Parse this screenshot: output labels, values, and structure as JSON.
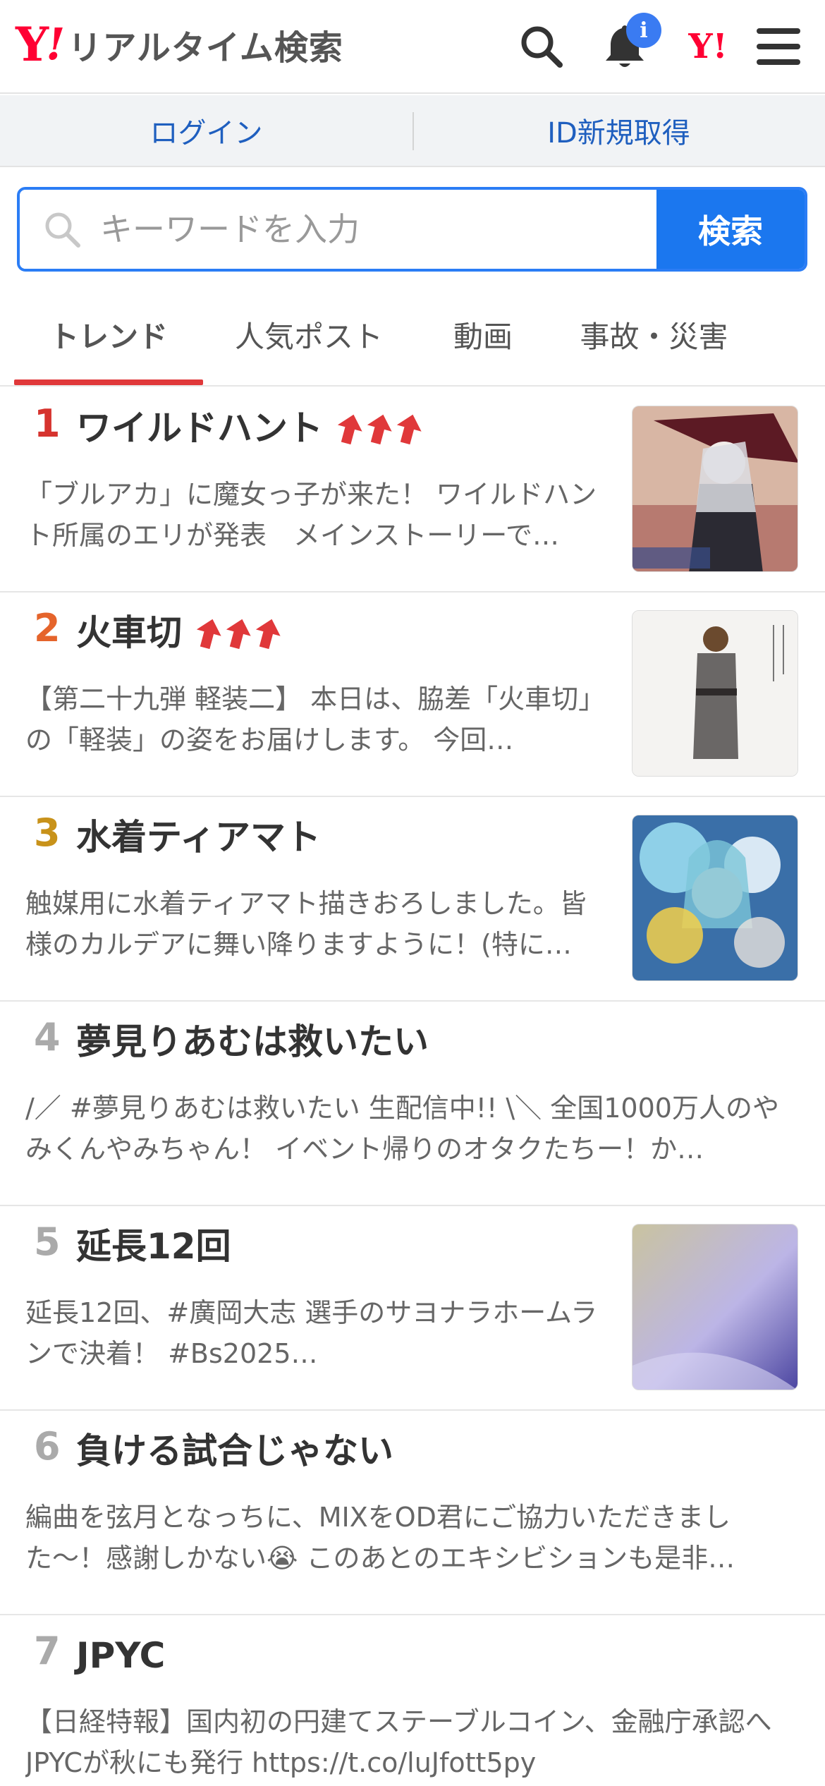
{
  "header": {
    "logo_text": "リアルタイム検索",
    "logo_y": "Y",
    "logo_ex": "!",
    "notification_badge": "i",
    "yahoo_small": "Y!",
    "icons": [
      "search-icon",
      "bell-icon",
      "yahoo-icon",
      "menu-icon"
    ]
  },
  "login": {
    "login_label": "ログイン",
    "register_label": "ID新規取得"
  },
  "search": {
    "placeholder": "キーワードを入力",
    "button_label": "検索"
  },
  "tabs": [
    {
      "label": "トレンド",
      "active": true
    },
    {
      "label": "人気ポスト",
      "active": false
    },
    {
      "label": "動画",
      "active": false
    },
    {
      "label": "事故・災害",
      "active": false
    }
  ],
  "colors": {
    "accent": "#1b77ef",
    "brand_red": "#ff0033",
    "rank1": "#d6332e",
    "rank2": "#e5642b",
    "rank3": "#c8921a",
    "rank_other": "#aaaaaa",
    "arrow": "#e0383a"
  },
  "trends": [
    {
      "rank": "1",
      "title": "ワイルドハント",
      "arrows": 3,
      "description": "「ブルアカ」に魔女っ子が来た！ ワイルドハント所属のエリが発表　メインストーリーで…",
      "has_thumb": true
    },
    {
      "rank": "2",
      "title": "火車切",
      "arrows": 3,
      "description": "【第二十九弾 軽装二】 本日は、脇差「火車切」の「軽装」の姿をお届けします。 今回…",
      "has_thumb": true
    },
    {
      "rank": "3",
      "title": "水着ティアマト",
      "arrows": 0,
      "description": "触媒用に水着ティアマト描きおろしました。皆様のカルデアに舞い降りますように！(特に…",
      "has_thumb": true
    },
    {
      "rank": "4",
      "title": "夢見りあむは救いたい",
      "arrows": 0,
      "description": "/／ #夢見りあむは救いたい 生配信中!! \\＼ 全国1000万人のやみくんやみちゃん！ イベント帰りのオタクたちー！か…",
      "has_thumb": false
    },
    {
      "rank": "5",
      "title": "延長12回",
      "arrows": 0,
      "description": "延長12回、#廣岡大志 選手のサヨナラホームランで決着！ #Bs2025…",
      "has_thumb": true
    },
    {
      "rank": "6",
      "title": "負ける試合じゃない",
      "arrows": 0,
      "description": "編曲を弦月となっちに、MIXをOD君にご協力いただきました〜！感謝しかない😭 このあとのエキシビションも是非…",
      "has_thumb": false
    },
    {
      "rank": "7",
      "title": "JPYC",
      "arrows": 0,
      "description": "【日経特報】国内初の円建てステーブルコイン、金融庁承認へ　JPYCが秋にも発行 https://t.co/luJfott5py",
      "has_thumb": false
    }
  ]
}
